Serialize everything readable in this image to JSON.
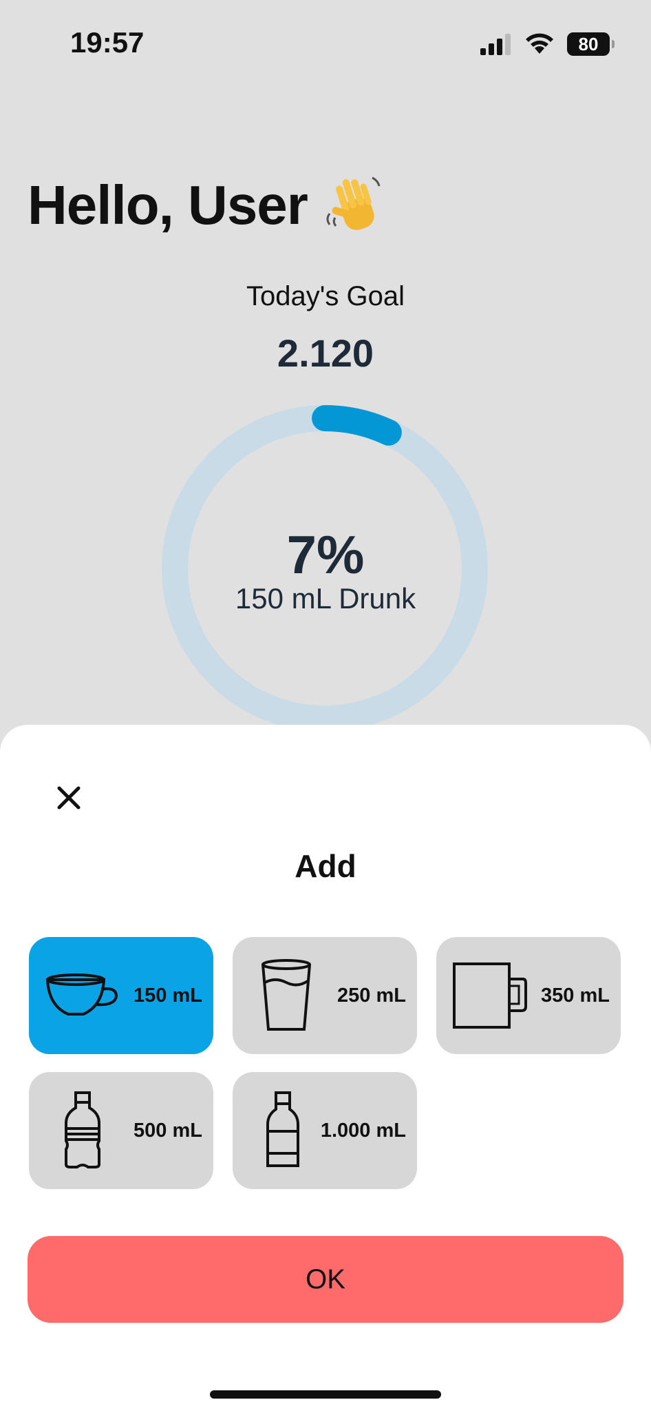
{
  "status_bar": {
    "time": "19:57",
    "battery": "80",
    "icons": [
      "cellular-signal-icon",
      "wifi-icon",
      "battery-icon"
    ]
  },
  "header": {
    "greeting": "Hello, User",
    "greeting_emoji": "waving-hand-icon"
  },
  "goal": {
    "label": "Today's Goal",
    "value": "2.120"
  },
  "progress": {
    "percent_label": "7%",
    "fraction": 0.07,
    "drunk_label": "150 mL Drunk",
    "track_color": "#c9dbe6",
    "fill_color": "#0397d6"
  },
  "sheet": {
    "title": "Add",
    "close_icon": "close-icon",
    "options": [
      {
        "label": "150 mL",
        "icon": "cup-icon",
        "selected": true
      },
      {
        "label": "250 mL",
        "icon": "glass-icon",
        "selected": false
      },
      {
        "label": "350 mL",
        "icon": "mug-icon",
        "selected": false
      },
      {
        "label": "500 mL",
        "icon": "small-bottle-icon",
        "selected": false
      },
      {
        "label": "1.000 mL",
        "icon": "large-bottle-icon",
        "selected": false
      }
    ],
    "ok_label": "OK"
  },
  "colors": {
    "background": "#e0e0e0",
    "selected_option": "#0aa3e6",
    "unselected_option": "#d7d7d7",
    "ok_button": "#ff6b6b"
  }
}
